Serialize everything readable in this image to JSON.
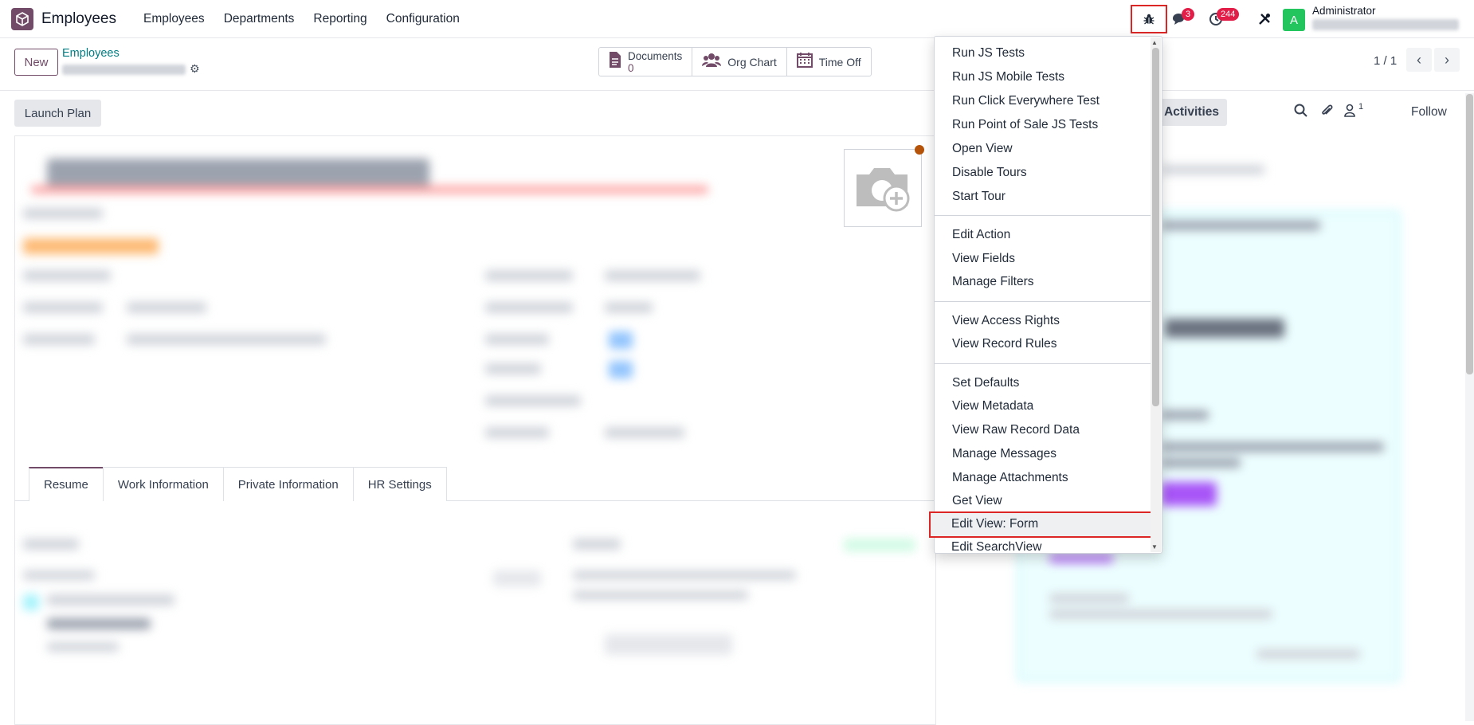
{
  "navbar": {
    "app_name": "Employees",
    "menu": [
      "Employees",
      "Departments",
      "Reporting",
      "Configuration"
    ],
    "messages_count": "3",
    "activities_count": "244",
    "user_initial": "A",
    "user_name": "Administrator"
  },
  "control": {
    "new_label": "New",
    "breadcrumb": "Employees",
    "smart_buttons": {
      "documents_label": "Documents",
      "documents_count": "0",
      "org_chart_label": "Org Chart",
      "time_off_label": "Time Off"
    },
    "pager": "1 / 1"
  },
  "form": {
    "launch_plan_label": "Launch Plan",
    "tabs": [
      "Resume",
      "Work Information",
      "Private Information",
      "HR Settings"
    ]
  },
  "chatter": {
    "activities_label": "Activities",
    "followers_count": "1",
    "follow_label": "Follow"
  },
  "debug_menu": {
    "group1": [
      "Run JS Tests",
      "Run JS Mobile Tests",
      "Run Click Everywhere Test",
      "Run Point of Sale JS Tests",
      "Open View",
      "Disable Tours",
      "Start Tour"
    ],
    "group2": [
      "Edit Action",
      "View Fields",
      "Manage Filters"
    ],
    "group3": [
      "View Access Rights",
      "View Record Rules"
    ],
    "group4": [
      "Set Defaults",
      "View Metadata",
      "View Raw Record Data",
      "Manage Messages",
      "Manage Attachments",
      "Get View",
      "Edit View: Form",
      "Edit SearchView"
    ]
  },
  "colors": {
    "brand": "#714b67",
    "highlight_border": "#dc2626",
    "badge": "#e11d48",
    "avatar": "#22c55e",
    "link": "#017e84"
  }
}
